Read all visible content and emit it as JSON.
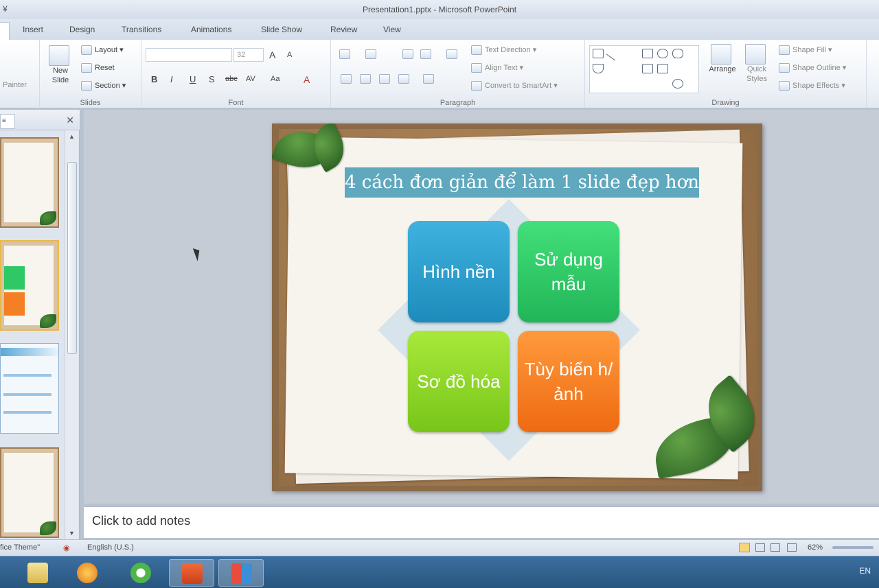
{
  "window": {
    "qat_glyph": "¥",
    "title": "Presentation1.pptx - Microsoft PowerPoint"
  },
  "tabs": [
    "Insert",
    "Design",
    "Transitions",
    "Animations",
    "Slide Show",
    "Review",
    "View"
  ],
  "ribbon": {
    "clipboard": {
      "format_painter": "Painter"
    },
    "slides": {
      "new_slide": "New Slide",
      "layout": "Layout",
      "reset": "Reset",
      "section": "Section",
      "group_label": "Slides"
    },
    "font": {
      "font_size": "32",
      "grow": "A",
      "shrink": "A",
      "bold": "B",
      "italic": "I",
      "underline": "U",
      "strike": "S",
      "abc": "abc",
      "spacing": "AV",
      "case": "Aa",
      "color": "A",
      "group_label": "Font"
    },
    "paragraph": {
      "text_direction": "Text Direction",
      "align_text": "Align Text",
      "smartart": "Convert to SmartArt",
      "group_label": "Paragraph"
    },
    "drawing": {
      "arrange": "Arrange",
      "quick_styles": "Quick Styles",
      "shape_fill": "Shape Fill",
      "shape_outline": "Shape Outline",
      "shape_effects": "Shape Effects",
      "group_label": "Drawing"
    }
  },
  "left_pane": {
    "tab_glyph": "≡",
    "close_glyph": "✕"
  },
  "slide": {
    "title": "4 cách đơn giản để làm 1 slide đẹp hơn",
    "tiles": [
      {
        "label": "Hình nền",
        "color": "#2aa0cf"
      },
      {
        "label": "Sử dụng mẫu",
        "color": "#2fc866"
      },
      {
        "label": "Sơ đồ hóa",
        "color": "#8fd62a"
      },
      {
        "label": "Tùy biến h/ảnh",
        "color": "#f47f24"
      }
    ]
  },
  "notes": {
    "placeholder": "Click to add notes"
  },
  "status": {
    "theme": "fice Theme\"",
    "language": "English (U.S.)",
    "zoom": "62%"
  },
  "taskbar": {
    "tray_lang": "EN"
  }
}
